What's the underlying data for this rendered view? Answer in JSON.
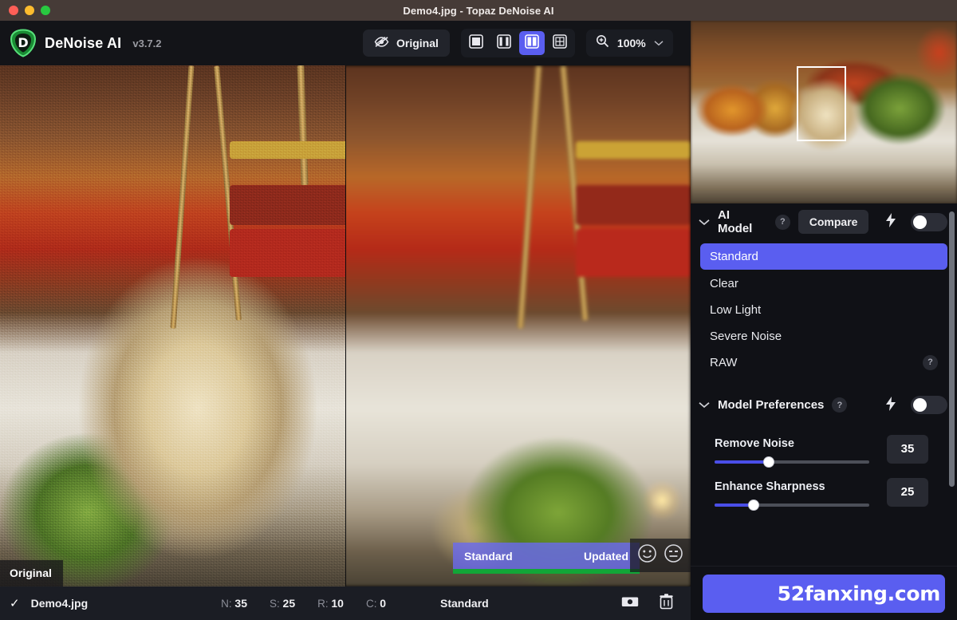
{
  "window": {
    "title": "Demo4.jpg - Topaz DeNoise AI",
    "traffic_lights": [
      "close",
      "minimize",
      "zoom"
    ]
  },
  "toolbar": {
    "brand_name": "DeNoise AI",
    "version": "v3.7.2",
    "logo_letter": "D",
    "original_button": "Original",
    "original_icon": "eye-slash-icon",
    "view_modes": [
      {
        "name": "single-view",
        "icon": "single-pane-icon",
        "active": false
      },
      {
        "name": "split-three-view",
        "icon": "three-pane-icon",
        "active": false
      },
      {
        "name": "split-two-view",
        "icon": "two-pane-icon",
        "active": true
      },
      {
        "name": "quad-view",
        "icon": "quad-pane-icon",
        "active": false
      }
    ],
    "zoom_icon": "magnifier-plus-icon",
    "zoom_level": "100%",
    "zoom_chevron": "chevron-down-icon"
  },
  "canvas": {
    "left_label": "Original",
    "right_badge_model": "Standard",
    "right_badge_status": "Updated",
    "feedback_icons": [
      "happy-face-icon",
      "neutral-face-icon"
    ]
  },
  "navigator": {
    "name": "navigator-thumbnail",
    "viewport_rect": "crop-region-rect"
  },
  "ai_model": {
    "section_title": "AI Model",
    "help_label": "?",
    "compare_label": "Compare",
    "auto_icon": "lightning-bolt-icon",
    "toggle_state": "off",
    "models": [
      {
        "label": "Standard",
        "selected": true,
        "help": false
      },
      {
        "label": "Clear",
        "selected": false,
        "help": false
      },
      {
        "label": "Low Light",
        "selected": false,
        "help": false
      },
      {
        "label": "Severe Noise",
        "selected": false,
        "help": false
      },
      {
        "label": "RAW",
        "selected": false,
        "help": true
      }
    ]
  },
  "model_preferences": {
    "section_title": "Model Preferences",
    "help_label": "?",
    "auto_icon": "lightning-bolt-icon",
    "toggle_state": "off",
    "sliders": [
      {
        "label": "Remove Noise",
        "value": "35",
        "percent": 35
      },
      {
        "label": "Enhance Sharpness",
        "value": "25",
        "percent": 25
      }
    ]
  },
  "footer": {
    "save_button_label": "",
    "watermark": "52fanxing.com"
  },
  "statusbar": {
    "check_icon": "checkmark-icon",
    "filename": "Demo4.jpg",
    "params": [
      {
        "key": "N:",
        "value": "35"
      },
      {
        "key": "S:",
        "value": "25"
      },
      {
        "key": "R:",
        "value": "10"
      },
      {
        "key": "C:",
        "value": "0"
      }
    ],
    "model": "Standard",
    "icons": [
      "preview-icon",
      "trash-icon"
    ]
  },
  "colors": {
    "accent": "#5a5ef0",
    "titlebar": "#463b37",
    "panel_bg": "#101116",
    "statusbar_bg": "#1b1d24",
    "progress_green": "#12a637",
    "logo_green": "#2bb14a"
  }
}
